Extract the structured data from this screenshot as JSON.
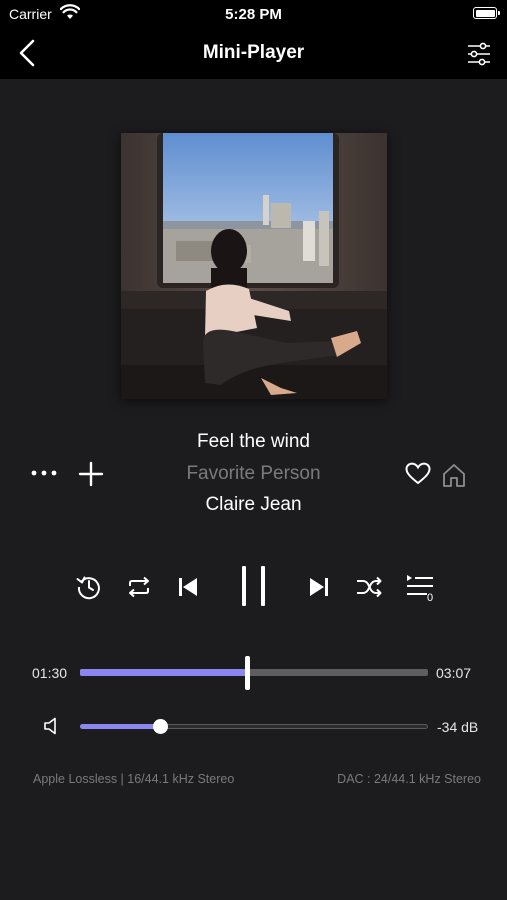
{
  "status_bar": {
    "carrier": "Carrier",
    "time": "5:28 PM"
  },
  "nav": {
    "title": "Mini-Player"
  },
  "track": {
    "title": "Feel the wind",
    "album": "Favorite Person",
    "artist": "Claire Jean"
  },
  "playback": {
    "state": "playing",
    "elapsed": "01:30",
    "duration": "03:07",
    "progress_fraction": 0.48,
    "queue_count": "0"
  },
  "volume": {
    "level_fraction": 0.23,
    "db_label": "-34 dB"
  },
  "audio_info": {
    "format": "Apple Lossless | 16/44.1 kHz Stereo",
    "dac": "DAC : 24/44.1 kHz Stereo"
  },
  "colors": {
    "accent": "#8c86f0",
    "background": "#1c1c1e",
    "bar": "#000000",
    "muted_text": "#7b7b7d"
  },
  "icons": [
    "wifi-icon",
    "battery-icon",
    "back-chevron-icon",
    "equalizer-settings-icon",
    "more-icon",
    "add-icon",
    "heart-icon",
    "home-icon",
    "rewind-15-icon",
    "repeat-icon",
    "previous-track-icon",
    "pause-icon",
    "next-track-icon",
    "shuffle-icon",
    "queue-list-icon",
    "speaker-icon"
  ]
}
